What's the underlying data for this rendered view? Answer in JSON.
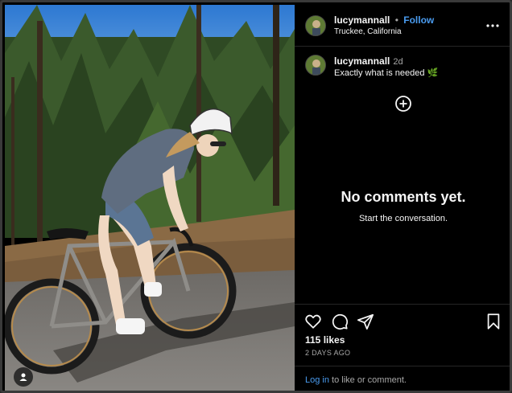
{
  "post": {
    "username": "lucymannall",
    "separator": "•",
    "follow_label": "Follow",
    "location": "Truckee, California",
    "more_icon": "more-horizontal-icon"
  },
  "caption": {
    "username": "lucymannall",
    "time": "2d",
    "text": "Exactly what is needed 🌿"
  },
  "comments": {
    "empty_title": "No comments yet.",
    "empty_subtitle": "Start the conversation."
  },
  "actions": {
    "icons": [
      "heart-icon",
      "comment-icon",
      "share-icon",
      "bookmark-icon"
    ],
    "likes": "115 likes",
    "time_ago": "2 DAYS AGO",
    "login_link": "Log in",
    "login_suffix": " to like or comment."
  },
  "colors": {
    "background": "#000000",
    "text": "#f5f5f5",
    "secondary_text": "#a8a8a8",
    "link": "#4a9cf0",
    "divider": "#262626"
  }
}
